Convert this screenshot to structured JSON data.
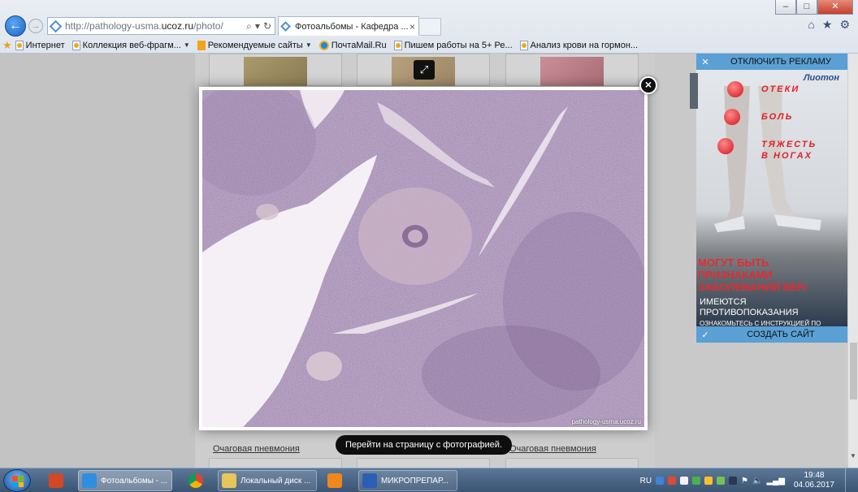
{
  "window": {
    "minimize": "–",
    "maximize": "□",
    "close": "✕"
  },
  "toolbar": {
    "url_prefix": "http://pathology-usma.",
    "url_domain": "ucoz.ru",
    "url_suffix": "/photo/",
    "search_glyph": "⌕",
    "refresh_glyph": "↻",
    "tab_title": "Фотоальбомы - Кафедра ...",
    "tab_close": "×"
  },
  "favorites": [
    {
      "label": "Интернет",
      "icon": "ie-page-icon"
    },
    {
      "label": "Коллекция веб-фрагм...",
      "icon": "ie-page-icon",
      "dropdown": true
    },
    {
      "label": "Рекомендуемые сайты",
      "icon": "bing-icon",
      "dropdown": true
    },
    {
      "label": "ПочтаMail.Ru",
      "icon": "mailru-icon"
    },
    {
      "label": "Пишем работы на 5+ Ре...",
      "icon": "ie-page-icon"
    },
    {
      "label": "Анализ крови на гормон...",
      "icon": "ie-page-icon"
    }
  ],
  "gallery": {
    "captions": [
      "Очаговая пневмония",
      "Очаговая пневмония"
    ],
    "tooltip": "Перейти на страницу с фотографией.",
    "watermark": "pathology-usma.ucoz.ru"
  },
  "ad": {
    "disable": "ОТКЛЮЧИТЬ РЕКЛАМУ",
    "brand": "Лиотон",
    "words": [
      "ОТЕКИ",
      "БОЛЬ",
      "ТЯЖЕСТЬ",
      "В НОГАХ"
    ],
    "headline": "МОГУТ БЫТЬ ПРИЗНАКАМИ ЗАБОЛЕВАНИЙ ВЕН:",
    "contra": "ИМЕЮТСЯ ПРОТИВОПОКАЗАНИЯ",
    "contra_sub": "ОЗНАКОМЬТЕСЬ С ИНСТРУКЦИЕЙ ПО ПРИМЕНЕНИЮ",
    "create_site": "СОЗДАТЬ САЙТ"
  },
  "taskbar": {
    "items": [
      {
        "label": "Фотоальбомы - ...",
        "color": "#2f8ee0"
      },
      {
        "label": "Локальный диск ...",
        "color": "#e7c55a"
      },
      {
        "label": "МИКРОПРЕПАР...",
        "color": "#2b5fb5"
      }
    ],
    "language": "RU",
    "time": "19:48",
    "date": "04.06.2017"
  },
  "colors": {
    "accent": "#5aa0d4",
    "ad_red": "#e52b30"
  }
}
